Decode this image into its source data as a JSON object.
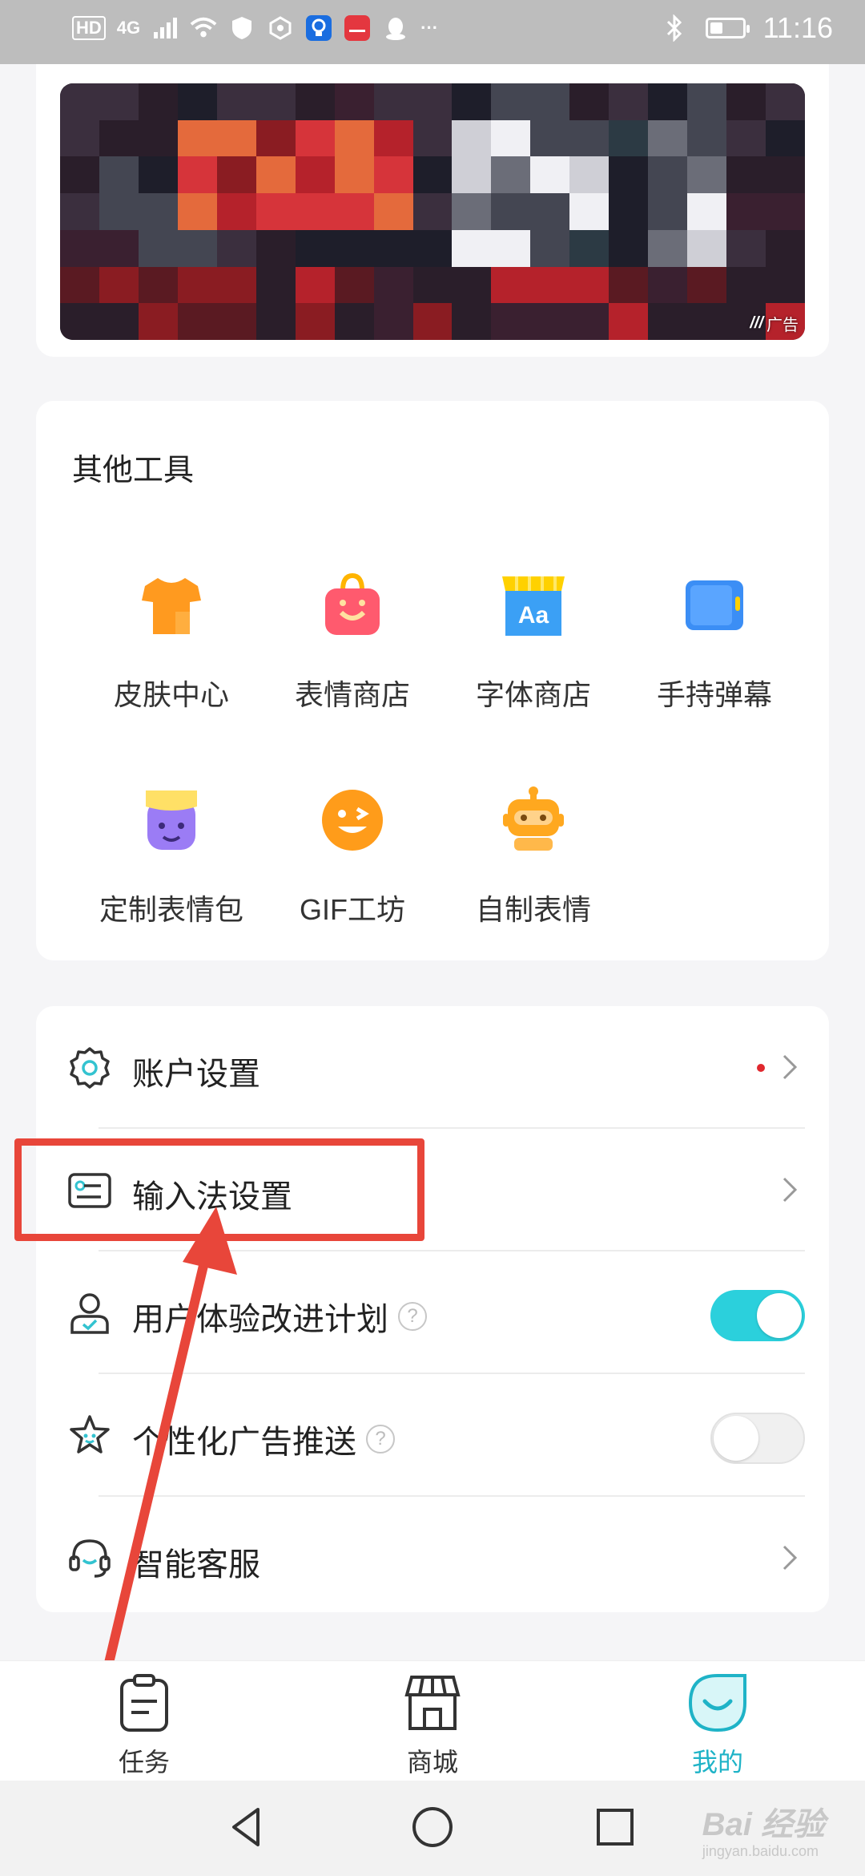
{
  "status_bar": {
    "left_badges": [
      "HD",
      "4G"
    ],
    "time": "11:16",
    "battery_level": 0.4
  },
  "banner": {
    "ad_label": "广告"
  },
  "tools": {
    "title": "其他工具",
    "items": [
      {
        "label": "皮肤中心",
        "icon": "tshirt-icon"
      },
      {
        "label": "表情商店",
        "icon": "smile-bag-icon"
      },
      {
        "label": "字体商店",
        "icon": "font-store-icon"
      },
      {
        "label": "手持弹幕",
        "icon": "handheld-danmaku-icon"
      },
      {
        "label": "定制表情包",
        "icon": "custom-emoji-icon"
      },
      {
        "label": "GIF工坊",
        "icon": "gif-wink-icon"
      },
      {
        "label": "自制表情",
        "icon": "robot-icon"
      }
    ]
  },
  "settings": {
    "rows": [
      {
        "label": "账户设置",
        "icon": "gear-icon",
        "control": "chevron",
        "red_dot": true
      },
      {
        "label": "输入法设置",
        "icon": "keyboard-settings-icon",
        "control": "chevron",
        "red_dot": false
      },
      {
        "label": "用户体验改进计划",
        "icon": "user-check-icon",
        "control": "toggle",
        "toggle_on": true,
        "help": "?"
      },
      {
        "label": "个性化广告推送",
        "icon": "star-face-icon",
        "control": "toggle",
        "toggle_on": false,
        "help": "?"
      },
      {
        "label": "智能客服",
        "icon": "headset-icon",
        "control": "chevron",
        "red_dot": false
      }
    ]
  },
  "bottom_nav": {
    "items": [
      {
        "label": "任务",
        "icon": "clipboard-icon",
        "active": false
      },
      {
        "label": "商城",
        "icon": "store-icon",
        "active": false
      },
      {
        "label": "我的",
        "icon": "profile-drop-icon",
        "active": true
      }
    ]
  },
  "watermark": {
    "text": "Bai 经验",
    "sub": "jingyan.baidu.com"
  },
  "colors": {
    "accent": "#2bd0dc",
    "annotation": "#e8463a",
    "active_nav": "#1fb3c7"
  }
}
